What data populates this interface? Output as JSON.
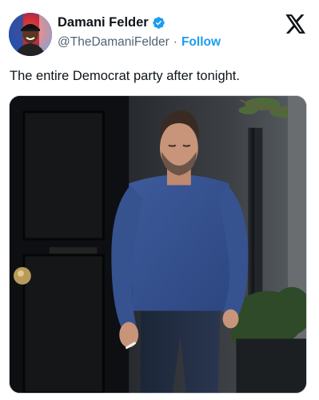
{
  "author": {
    "display_name": "Damani Felder",
    "handle": "@TheDamaniFelder",
    "separator": "·",
    "follow_label": "Follow"
  },
  "tweet": {
    "text": "The entire Democrat party after tonight."
  },
  "icons": {
    "verified": "verified-badge-icon",
    "platform": "x-logo-icon"
  },
  "colors": {
    "link_blue": "#1d9bf0",
    "secondary_text": "#536471",
    "primary_text": "#0f1419"
  }
}
